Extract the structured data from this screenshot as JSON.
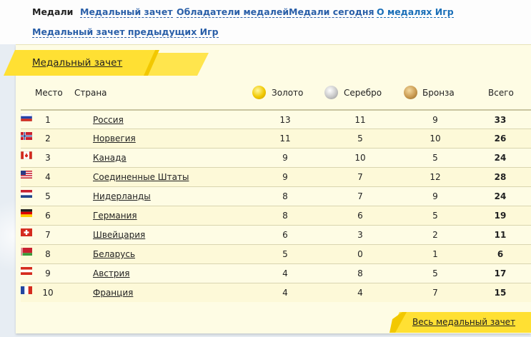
{
  "nav": {
    "items": [
      {
        "label": "Медали"
      },
      {
        "label": "Медальный зачет"
      },
      {
        "label": "Обладатели медалей"
      },
      {
        "label": "Медали сегодня"
      },
      {
        "label": "О медалях Игр"
      },
      {
        "label": "Медальный зачет предыдущих Игр"
      }
    ]
  },
  "panel": {
    "tab_label": "Медальный зачет",
    "footer_link": "Весь медальный зачет"
  },
  "table": {
    "headers": {
      "place": "Место",
      "country": "Страна",
      "gold": "Золото",
      "silver": "Серебро",
      "bronze": "Бронза",
      "total": "Всего"
    },
    "rows": [
      {
        "place": "1",
        "flag": "russia-flag-icon",
        "country": "Россия",
        "gold": "13",
        "silver": "11",
        "bronze": "9",
        "total": "33"
      },
      {
        "place": "2",
        "flag": "norway-flag-icon",
        "country": "Норвегия",
        "gold": "11",
        "silver": "5",
        "bronze": "10",
        "total": "26"
      },
      {
        "place": "3",
        "flag": "canada-flag-icon",
        "country": "Канада",
        "gold": "9",
        "silver": "10",
        "bronze": "5",
        "total": "24"
      },
      {
        "place": "4",
        "flag": "usa-flag-icon",
        "country": "Соединенные Штаты",
        "gold": "9",
        "silver": "7",
        "bronze": "12",
        "total": "28"
      },
      {
        "place": "5",
        "flag": "netherlands-flag-icon",
        "country": "Нидерланды",
        "gold": "8",
        "silver": "7",
        "bronze": "9",
        "total": "24"
      },
      {
        "place": "6",
        "flag": "germany-flag-icon",
        "country": "Германия",
        "gold": "8",
        "silver": "6",
        "bronze": "5",
        "total": "19"
      },
      {
        "place": "7",
        "flag": "switzerland-flag-icon",
        "country": "Швейцария",
        "gold": "6",
        "silver": "3",
        "bronze": "2",
        "total": "11"
      },
      {
        "place": "8",
        "flag": "belarus-flag-icon",
        "country": "Беларусь",
        "gold": "5",
        "silver": "0",
        "bronze": "1",
        "total": "6"
      },
      {
        "place": "9",
        "flag": "austria-flag-icon",
        "country": "Австрия",
        "gold": "4",
        "silver": "8",
        "bronze": "5",
        "total": "17"
      },
      {
        "place": "10",
        "flag": "france-flag-icon",
        "country": "Франция",
        "gold": "4",
        "silver": "4",
        "bronze": "7",
        "total": "15"
      }
    ]
  },
  "colors": {
    "link": "#2a5fa8",
    "panel_bg": "#fefce4",
    "tab_yellow": "#ffe033"
  }
}
